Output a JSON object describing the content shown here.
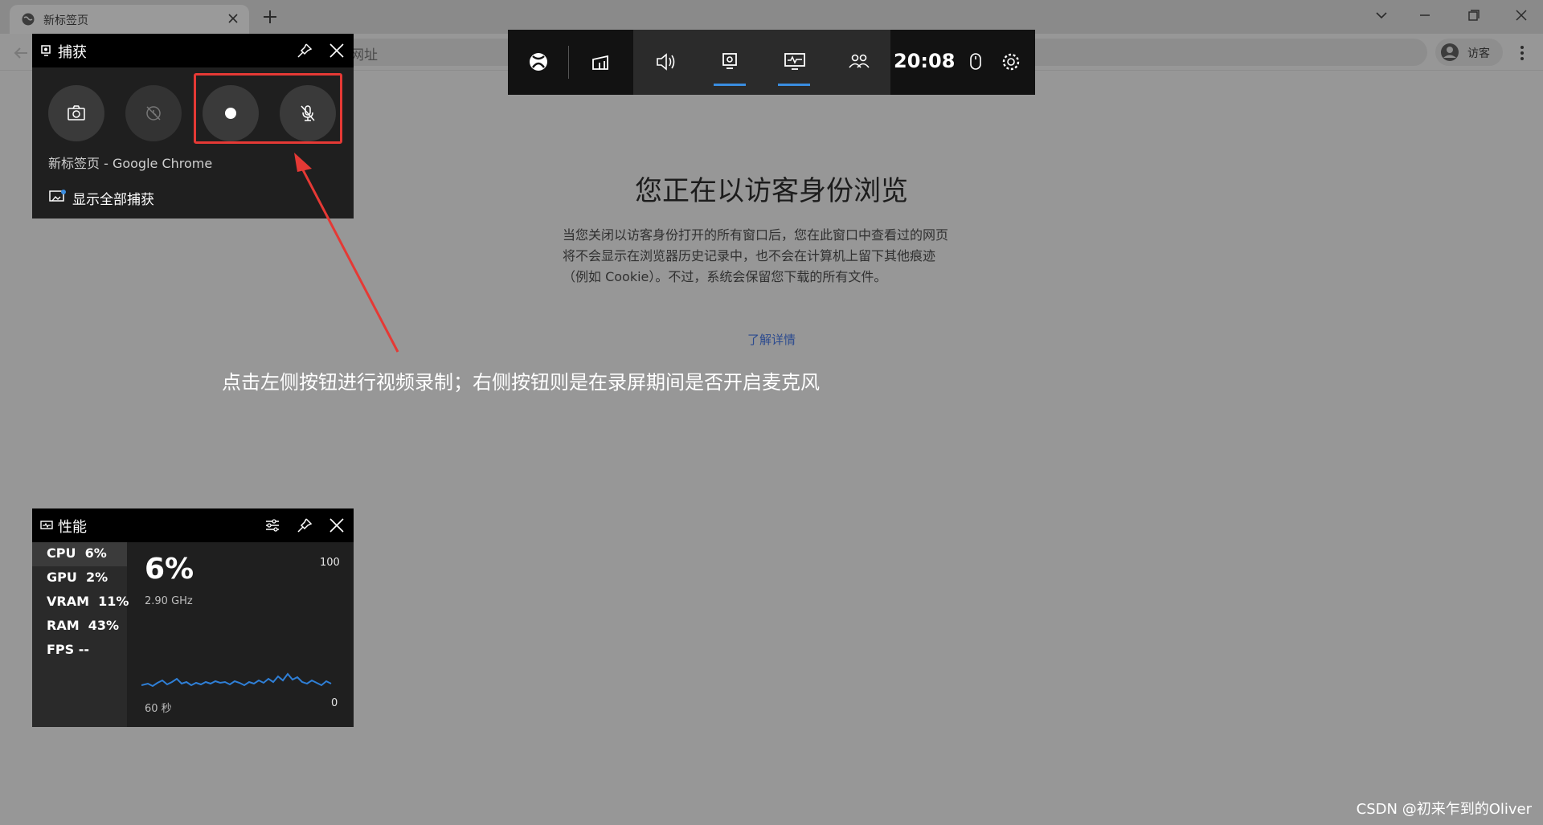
{
  "browser": {
    "tab_title": "新标签页",
    "omnibox_placeholder_fragment": "网址",
    "profile_label": "访客"
  },
  "page": {
    "title": "您正在以访客身份浏览",
    "description_lines": [
      "当您关闭以访客身份打开的所有窗口后，您在此窗口中查看过的网页",
      "将不会显示在浏览器历史记录中，也不会在计算机上留下其他痕迹",
      "（例如 Cookie）。不过，系统会保留您下载的所有文件。"
    ],
    "learn_more": "了解详情"
  },
  "gamebar": {
    "time": "20:08",
    "buttons": [
      "xbox-icon",
      "widget-menu-icon",
      "audio-icon",
      "capture-icon",
      "performance-icon",
      "social-icon",
      "mouse-icon",
      "settings-icon"
    ],
    "accent": "#3a8de0"
  },
  "capture_widget": {
    "title": "捕获",
    "source": "新标签页 - Google Chrome",
    "show_all": "显示全部捕获"
  },
  "perf_widget": {
    "title": "性能",
    "metrics": [
      {
        "name": "CPU",
        "value": "6%"
      },
      {
        "name": "GPU",
        "value": "2%"
      },
      {
        "name": "VRAM",
        "value": "11%"
      },
      {
        "name": "RAM",
        "value": "43%"
      },
      {
        "name": "FPS",
        "value": "--"
      }
    ],
    "big_value": "6%",
    "frequency": "2.90 GHz",
    "scale_max": "100",
    "scale_min": "0",
    "time_window": "60 秒"
  },
  "annotation": "点击左侧按钮进行视频录制；右侧按钮则是在录屏期间是否开启麦克风",
  "watermark": "CSDN @初来乍到的Oliver",
  "colors": {
    "highlight_red": "#e53935",
    "graph_blue": "#2f7fd6"
  }
}
